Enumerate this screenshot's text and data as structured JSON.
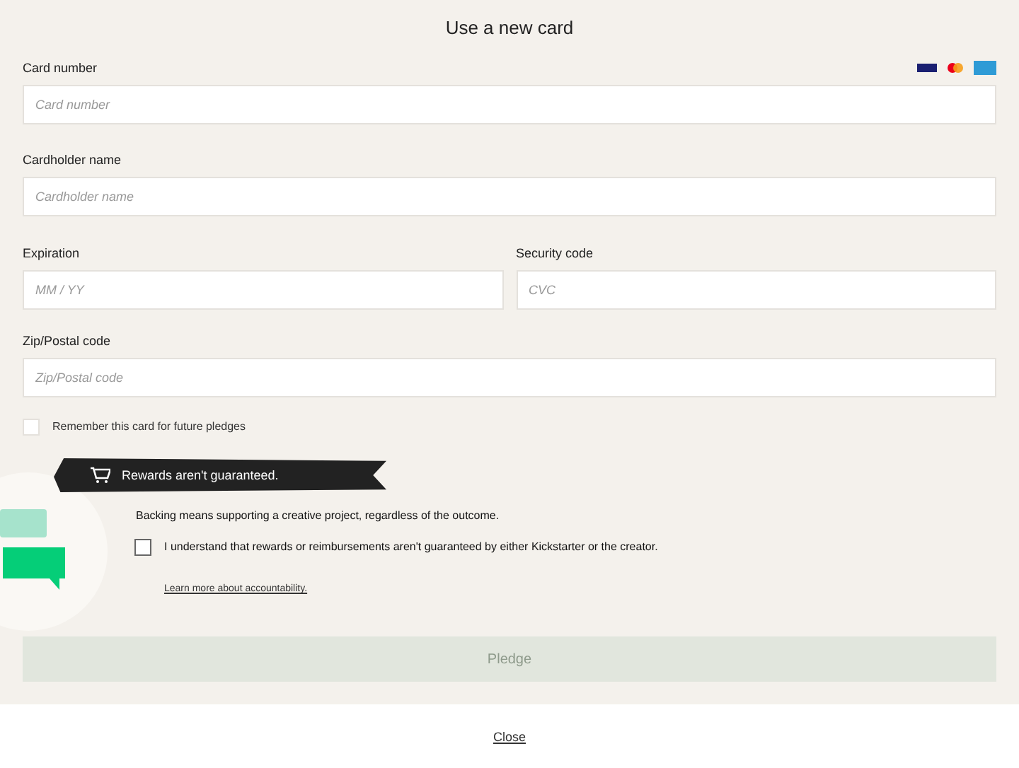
{
  "title": "Use a new card",
  "fields": [
    {
      "kind": "full",
      "label": "Card number",
      "placeholder": "Card number",
      "brands": true
    },
    {
      "kind": "full",
      "label": "Cardholder name",
      "placeholder": "Cardholder name"
    },
    {
      "kind": "pair",
      "items": [
        {
          "label": "Expiration",
          "placeholder": "MM / YY"
        },
        {
          "label": "Security code",
          "placeholder": "CVC"
        }
      ]
    },
    {
      "kind": "full",
      "label": "Zip/Postal code",
      "placeholder": "Zip/Postal code"
    }
  ],
  "remember": {
    "label": "Remember this card for future pledges",
    "checked": false
  },
  "notice": {
    "banner": "Rewards aren't guaranteed.",
    "text": "Backing means supporting a creative project, regardless of the outcome.",
    "agree": {
      "label": "I understand that rewards or reimbursements aren't guaranteed by either Kickstarter or the creator.",
      "checked": false
    },
    "link": "Learn more about accountability."
  },
  "pledge_button": {
    "label": "Pledge",
    "disabled": true
  },
  "close_link": "Close"
}
